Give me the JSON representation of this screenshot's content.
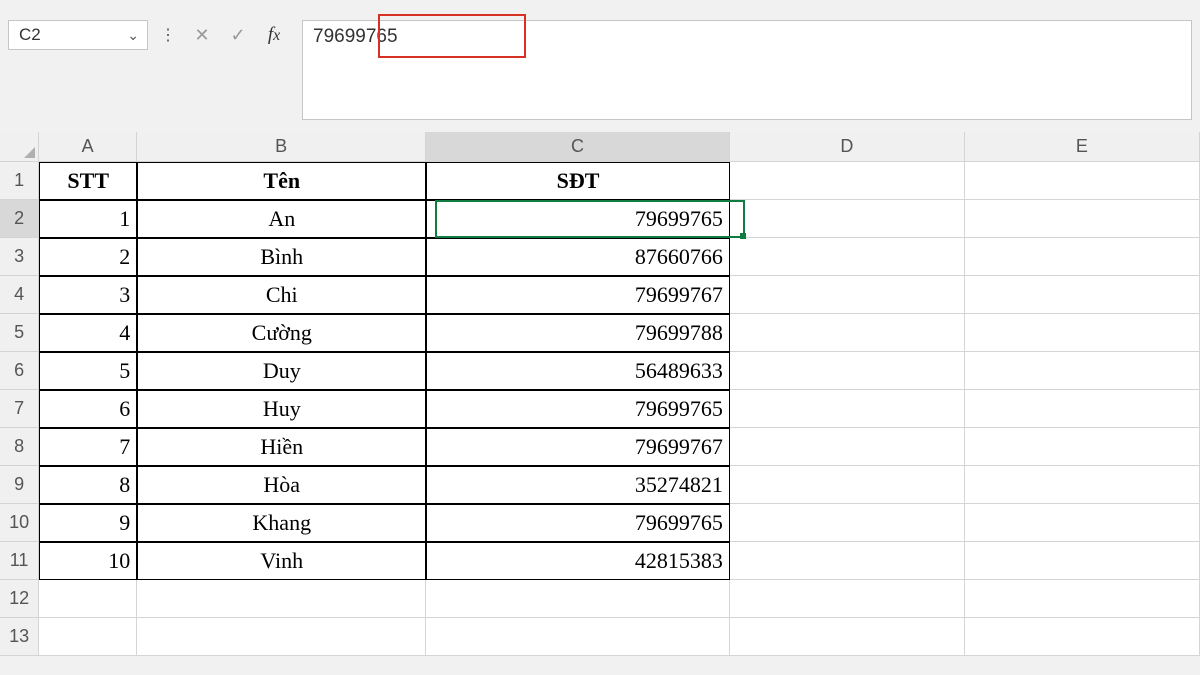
{
  "nameBox": "C2",
  "formulaValue": "79699765",
  "columns": [
    "A",
    "B",
    "C",
    "D",
    "E"
  ],
  "rowHeaders": [
    "1",
    "2",
    "3",
    "4",
    "5",
    "6",
    "7",
    "8",
    "9",
    "10",
    "11",
    "12",
    "13"
  ],
  "headersRow": {
    "a": "STT",
    "b": "Tên",
    "c": "SĐT"
  },
  "data": [
    {
      "stt": "1",
      "ten": "An",
      "sdt": "79699765"
    },
    {
      "stt": "2",
      "ten": "Bình",
      "sdt": "87660766"
    },
    {
      "stt": "3",
      "ten": "Chi",
      "sdt": "79699767"
    },
    {
      "stt": "4",
      "ten": "Cường",
      "sdt": "79699788"
    },
    {
      "stt": "5",
      "ten": "Duy",
      "sdt": "56489633"
    },
    {
      "stt": "6",
      "ten": "Huy",
      "sdt": "79699765"
    },
    {
      "stt": "7",
      "ten": "Hiền",
      "sdt": "79699767"
    },
    {
      "stt": "8",
      "ten": "Hòa",
      "sdt": "35274821"
    },
    {
      "stt": "9",
      "ten": "Khang",
      "sdt": "79699765"
    },
    {
      "stt": "10",
      "ten": "Vinh",
      "sdt": "42815383"
    }
  ],
  "selectedCell": "C2"
}
